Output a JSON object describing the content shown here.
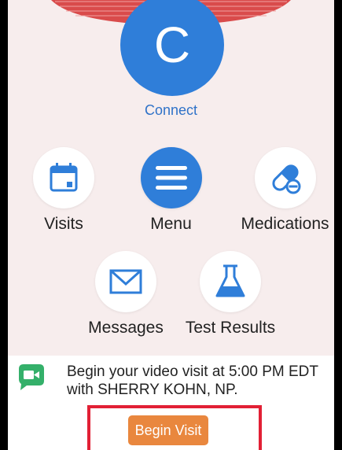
{
  "connect": {
    "initial": "C",
    "label": "Connect"
  },
  "tiles": [
    {
      "label": "Visits",
      "icon": "calendar-icon"
    },
    {
      "label": "Menu",
      "icon": "menu-icon"
    },
    {
      "label": "Medications",
      "icon": "pill-icon"
    },
    {
      "label": "Messages",
      "icon": "envelope-icon"
    },
    {
      "label": "Test Results",
      "icon": "flask-icon"
    }
  ],
  "visit_banner": {
    "message": "Begin your video visit at 5:00 PM EDT with SHERRY KOHN, NP.",
    "icon": "video-chat-icon",
    "button_label": "Begin Visit"
  },
  "colors": {
    "brand_blue": "#2F7ED9",
    "button_orange": "#E9873E",
    "highlight_red": "#E22035",
    "video_icon_green": "#34B06A",
    "header_red": "#D94B4B"
  }
}
